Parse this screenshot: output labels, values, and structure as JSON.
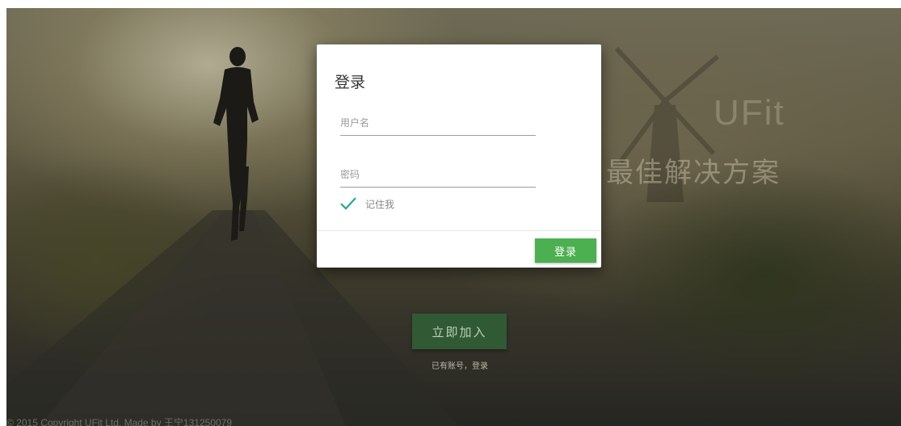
{
  "hero": {
    "brand": "UFit",
    "tagline": "最佳解决方案",
    "join_label": "立即加入",
    "login_link": "已有账号，登录",
    "copyright": "© 2015 Copyright UFit Ltd. Made by 王宁131250079"
  },
  "dialog": {
    "title": "登录",
    "username_placeholder": "用户名",
    "username_value": "",
    "password_placeholder": "密码",
    "password_value": "",
    "remember_label": "记住我",
    "remember_checked": true,
    "submit_label": "登录"
  },
  "colors": {
    "primary_green": "#4caf50",
    "join_green": "#2f5a33",
    "check_teal": "#26a69a"
  },
  "icons": {
    "remember": "check-icon"
  }
}
